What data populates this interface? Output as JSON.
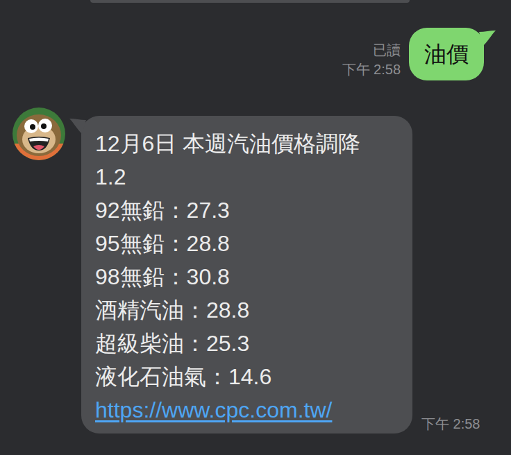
{
  "user_message": {
    "text": "油價",
    "read_label": "已讀",
    "time": "下午 2:58"
  },
  "bot_message": {
    "lines": [
      "12月6日 本週汽油價格調降 1.2",
      "92無鉛：27.3",
      "95無鉛：28.8",
      "98無鉛：30.8",
      "酒精汽油：28.8",
      "超級柴油：25.3",
      "液化石油氣：14.6"
    ],
    "link": "https://www.cpc.com.tw/",
    "time": "下午 2:58"
  }
}
